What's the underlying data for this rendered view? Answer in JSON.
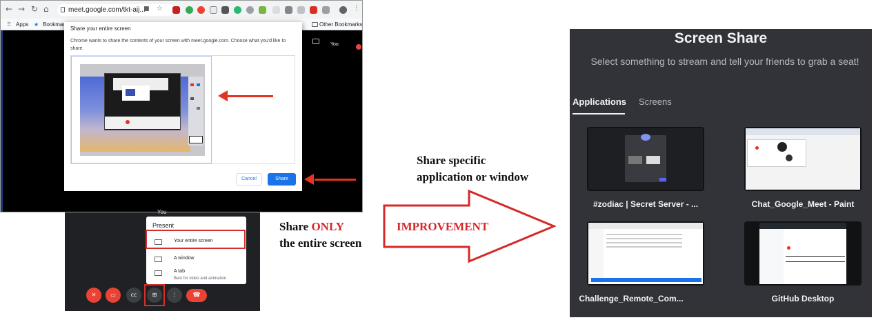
{
  "chrome": {
    "url": "meet.google.com/tkt-aij...",
    "bookmarks": {
      "apps": "Apps",
      "bookmarks": "Bookmark",
      "other": "Other Bookmarks"
    },
    "you_label": "You"
  },
  "share_dialog": {
    "title": "Share your entire screen",
    "description": "Chrome wants to share the contents of your screen with meet.google.com. Choose what you'd like to share.",
    "cancel": "Cancel",
    "share": "Share"
  },
  "meet": {
    "you_label": "You",
    "present_menu": {
      "title": "Present",
      "items": [
        {
          "label": "Your entire screen",
          "sublabel": ""
        },
        {
          "label": "A window",
          "sublabel": ""
        },
        {
          "label": "A tab",
          "sublabel": "Best for video and animation"
        }
      ]
    },
    "controls": [
      "mic-off-icon",
      "camera-off-icon",
      "captions-icon",
      "present-icon",
      "more-icon",
      "end-call-icon"
    ]
  },
  "annotations": {
    "left_line1_a": "Share ",
    "left_line1_b": "ONLY",
    "left_line2": "the entire screen",
    "improvement": "IMPROVEMENT",
    "right_line1": "Share specific",
    "right_line2": "application or window"
  },
  "discord": {
    "title": "Screen Share",
    "subtitle": "Select something to stream and tell your friends to grab a seat!",
    "tabs": [
      "Applications",
      "Screens"
    ],
    "active_tab": "Applications",
    "windows": [
      "#zodiac | Secret Server - ...",
      "Chat_Google_Meet - Paint",
      "Challenge_Remote_Com...",
      "GitHub Desktop"
    ]
  },
  "colors": {
    "annotation_red": "#d62828",
    "arrow_red": "#e53323",
    "chrome_blue": "#1a73e8",
    "discord_bg": "#313338"
  }
}
